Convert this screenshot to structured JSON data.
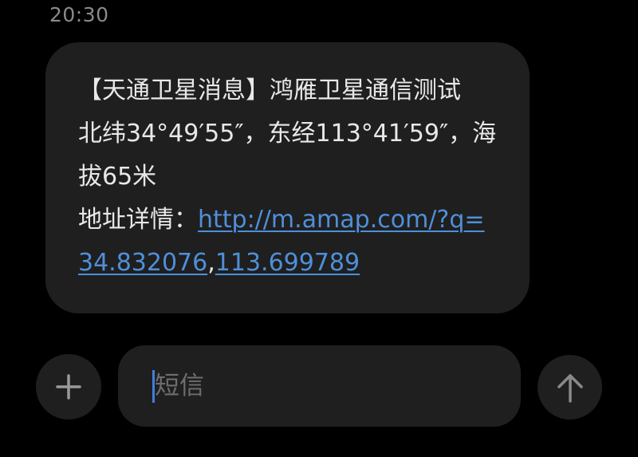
{
  "header": {
    "time": "20:30"
  },
  "message": {
    "line1": "【天通卫星消息】鸿雁卫星通信测试",
    "line2": "北纬34°49′55″，东经113°41′59″，海",
    "line3": "拔65米",
    "address_label": "地址详情：",
    "link_part1": "http://m.amap.com/?q=",
    "link_part2_a": "34.832076",
    "link_separator": ",",
    "link_part2_b": "113.699789"
  },
  "compose": {
    "placeholder": "短信",
    "value": ""
  },
  "icons": {
    "add": "plus-icon",
    "send": "arrow-up-icon"
  },
  "colors": {
    "background": "#000000",
    "bubble": "#1f1f1f",
    "link": "#4f8fd9",
    "cursor": "#3f7fe0",
    "icon": "#9a9a9a"
  }
}
